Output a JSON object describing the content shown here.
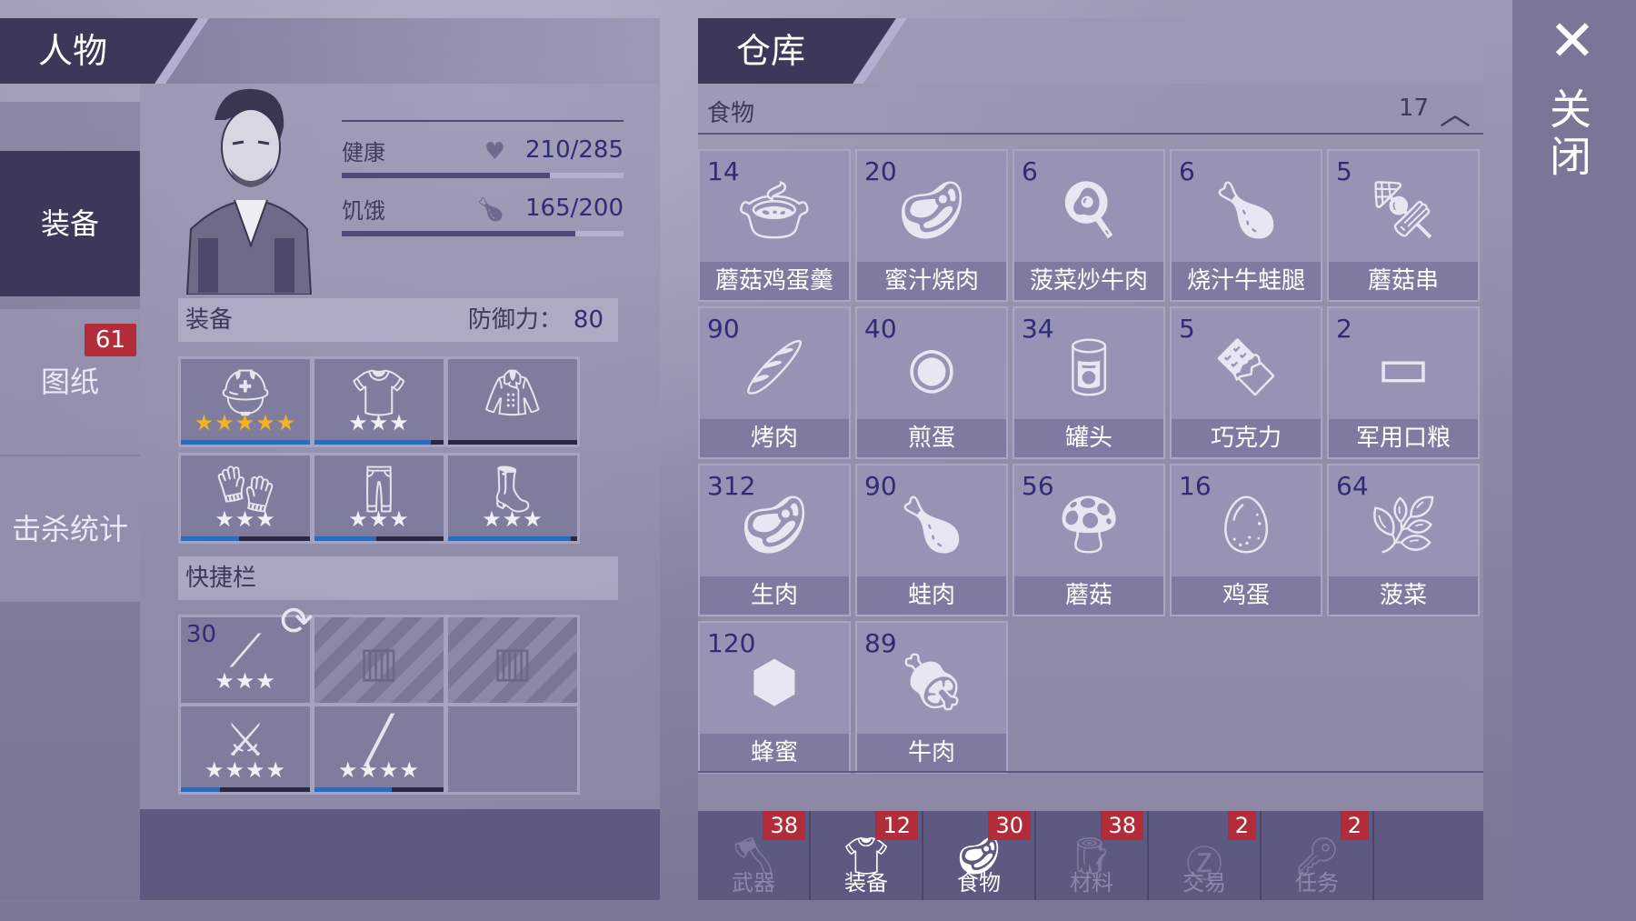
{
  "left": {
    "title": "人物",
    "side_tabs": [
      {
        "label": "装备",
        "active": true,
        "badge": ""
      },
      {
        "label": "图纸",
        "active": false,
        "badge": "61"
      },
      {
        "label": "击杀统计",
        "active": false,
        "badge": ""
      }
    ],
    "stats": {
      "health_label": "健康",
      "health_value": "210/285",
      "health_fraction": 0.74,
      "hunger_label": "饥饿",
      "hunger_value": "165/200",
      "hunger_fraction": 0.83
    },
    "equipment": {
      "header": "装备",
      "defense_label": "防御力：",
      "defense_value": "80",
      "slots": [
        {
          "icon": "helmet-icon",
          "stars": "★★★★★",
          "gold": true,
          "durability": 1.0
        },
        {
          "icon": "shirt-icon",
          "stars": "★★★",
          "gold": false,
          "durability": 0.9
        },
        {
          "icon": "jacket-icon",
          "stars": "",
          "gold": false,
          "durability": 0
        },
        {
          "icon": "gloves-icon",
          "stars": "★★★",
          "gold": false,
          "durability": 0.45
        },
        {
          "icon": "pants-icon",
          "stars": "★★★",
          "gold": false,
          "durability": 0.48
        },
        {
          "icon": "boots-icon",
          "stars": "★★★",
          "gold": false,
          "durability": 0.95
        }
      ]
    },
    "quickbar": {
      "header": "快捷栏",
      "slots": [
        {
          "icon": "spear-icon",
          "qty": "30",
          "stars": "★★★",
          "locked": false,
          "durability": 0
        },
        {
          "icon": "fence-icon",
          "qty": "",
          "stars": "",
          "locked": true,
          "durability": 0
        },
        {
          "icon": "fence-icon",
          "qty": "",
          "stars": "",
          "locked": true,
          "durability": 0
        },
        {
          "icon": "crossbow-icon",
          "qty": "",
          "stars": "★★★★",
          "locked": false,
          "durability": 0.3
        },
        {
          "icon": "baton-icon",
          "qty": "",
          "stars": "★★★★",
          "locked": false,
          "durability": 0.6
        },
        {
          "icon": "",
          "qty": "",
          "stars": "",
          "locked": false,
          "durability": 0
        }
      ]
    }
  },
  "right": {
    "title": "仓库",
    "category": {
      "name": "食物",
      "count": "17"
    },
    "items": [
      {
        "count": "14",
        "label": "蘑菇鸡蛋羹",
        "icon": "bowl-icon"
      },
      {
        "count": "20",
        "label": "蜜汁烧肉",
        "icon": "roast-meat-icon"
      },
      {
        "count": "6",
        "label": "菠菜炒牛肉",
        "icon": "pan-icon"
      },
      {
        "count": "6",
        "label": "烧汁牛蛙腿",
        "icon": "frog-legs-icon"
      },
      {
        "count": "5",
        "label": "蘑菇串",
        "icon": "skewer-icon"
      },
      {
        "count": "90",
        "label": "烤肉",
        "icon": "grilled-meat-icon"
      },
      {
        "count": "40",
        "label": "煎蛋",
        "icon": "fried-egg-icon"
      },
      {
        "count": "34",
        "label": "罐头",
        "icon": "can-icon"
      },
      {
        "count": "5",
        "label": "巧克力",
        "icon": "chocolate-icon"
      },
      {
        "count": "2",
        "label": "军用口粮",
        "icon": "ration-icon"
      },
      {
        "count": "312",
        "label": "生肉",
        "icon": "raw-meat-icon"
      },
      {
        "count": "90",
        "label": "蛙肉",
        "icon": "frog-meat-icon"
      },
      {
        "count": "56",
        "label": "蘑菇",
        "icon": "mushroom-icon"
      },
      {
        "count": "16",
        "label": "鸡蛋",
        "icon": "eggs-icon"
      },
      {
        "count": "64",
        "label": "菠菜",
        "icon": "spinach-icon"
      },
      {
        "count": "120",
        "label": "蜂蜜",
        "icon": "honeycomb-icon"
      },
      {
        "count": "89",
        "label": "牛肉",
        "icon": "beef-icon"
      }
    ],
    "bottom_tabs": [
      {
        "label": "武器",
        "badge": "38",
        "icon": "axe-icon",
        "active": false
      },
      {
        "label": "装备",
        "badge": "12",
        "icon": "tshirt-icon",
        "active": true
      },
      {
        "label": "食物",
        "badge": "30",
        "icon": "meat-icon",
        "active": true
      },
      {
        "label": "材料",
        "badge": "38",
        "icon": "log-icon",
        "active": false
      },
      {
        "label": "交易",
        "badge": "2",
        "icon": "coin-icon",
        "active": false
      },
      {
        "label": "任务",
        "badge": "2",
        "icon": "key-icon",
        "active": false
      }
    ]
  },
  "close": {
    "label": "关闭"
  }
}
